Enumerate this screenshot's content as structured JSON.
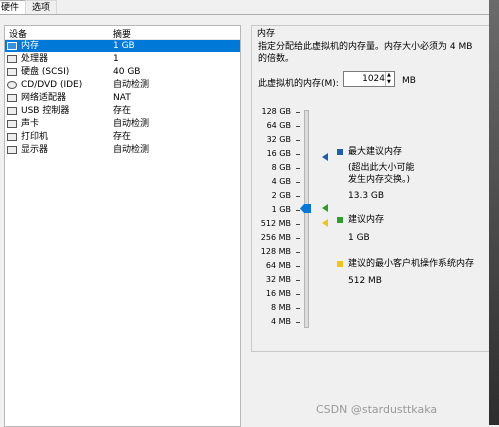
{
  "tabs": [
    "硬件",
    "选项"
  ],
  "device_list": {
    "headers": [
      "设备",
      "摘要"
    ],
    "rows": [
      {
        "icon": "memory-icon",
        "name": "内存",
        "summary": "1 GB"
      },
      {
        "icon": "cpu-icon",
        "name": "处理器",
        "summary": "1"
      },
      {
        "icon": "hard-disk-icon",
        "name": "硬盘 (SCSI)",
        "summary": "40 GB"
      },
      {
        "icon": "cd-dvd-icon",
        "name": "CD/DVD (IDE)",
        "summary": "自动检测"
      },
      {
        "icon": "network-adapter-icon",
        "name": "网络适配器",
        "summary": "NAT"
      },
      {
        "icon": "usb-controller-icon",
        "name": "USB 控制器",
        "summary": "存在"
      },
      {
        "icon": "sound-card-icon",
        "name": "声卡",
        "summary": "自动检测"
      },
      {
        "icon": "printer-icon",
        "name": "打印机",
        "summary": "存在"
      },
      {
        "icon": "display-icon",
        "name": "显示器",
        "summary": "自动检测"
      }
    ]
  },
  "memory": {
    "group_title": "内存",
    "description_line1": "指定分配给此虚拟机的内存量。内存大小必须为 4 MB",
    "description_line2": "的倍数。",
    "field_label": "此虚拟机的内存(M):",
    "value": "1024",
    "unit": "MB",
    "scale_labels": [
      "128 GB",
      "64 GB",
      "32 GB",
      "16 GB",
      "8 GB",
      "4 GB",
      "2 GB",
      "1 GB",
      "512 MB",
      "256 MB",
      "128 MB",
      "64 MB",
      "32 MB",
      "16 MB",
      "8 MB",
      "4 MB"
    ],
    "legend": {
      "max_recommended_title": "最大建议内存",
      "max_recommended_note1": "(超出此大小可能",
      "max_recommended_note2": "发生内存交换。)",
      "max_recommended_value": "13.3 GB",
      "recommended_title": "建议内存",
      "recommended_value": "1 GB",
      "min_guest_title": "建议的最小客户机操作系统内存",
      "min_guest_value": "512 MB"
    },
    "colors": {
      "max_marker": "#1f5fa8",
      "recommended_marker": "#2e9e2e",
      "min_marker": "#f0c419",
      "selection": "#0078d7"
    }
  },
  "watermark": "CSDN @stardusttkaka"
}
